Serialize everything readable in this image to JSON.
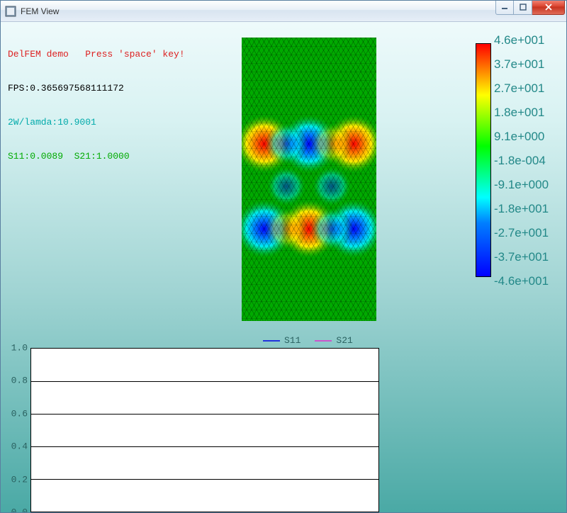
{
  "window": {
    "title": "FEM View"
  },
  "overlay": {
    "demo_line": "DelFEM demo   Press 'space' key!",
    "fps_line": "FPS:0.365697568111172",
    "lambda_line": "2W/lamda:10.9001",
    "sparams_line": "S11:0.0089  S21:1.0000"
  },
  "legend": {
    "s11_label": "S11",
    "s21_label": "S21"
  },
  "colorbar": {
    "labels": [
      "4.6e+001",
      "3.7e+001",
      "2.7e+001",
      "1.8e+001",
      "9.1e+000",
      "-1.8e-004",
      "-9.1e+000",
      "-1.8e+001",
      "-2.7e+001",
      "-3.7e+001",
      "-4.6e+001"
    ]
  },
  "chart_data": {
    "type": "line",
    "title": "",
    "xlabel": "",
    "ylabel": "",
    "ylim": [
      0.0,
      1.0
    ],
    "yticks": [
      1.0,
      0.8,
      0.6,
      0.4,
      0.2,
      0.0
    ],
    "x": [],
    "series": [
      {
        "name": "S11",
        "color": "#2233dd",
        "values": []
      },
      {
        "name": "S21",
        "color": "#cc55cc",
        "values": []
      }
    ]
  }
}
